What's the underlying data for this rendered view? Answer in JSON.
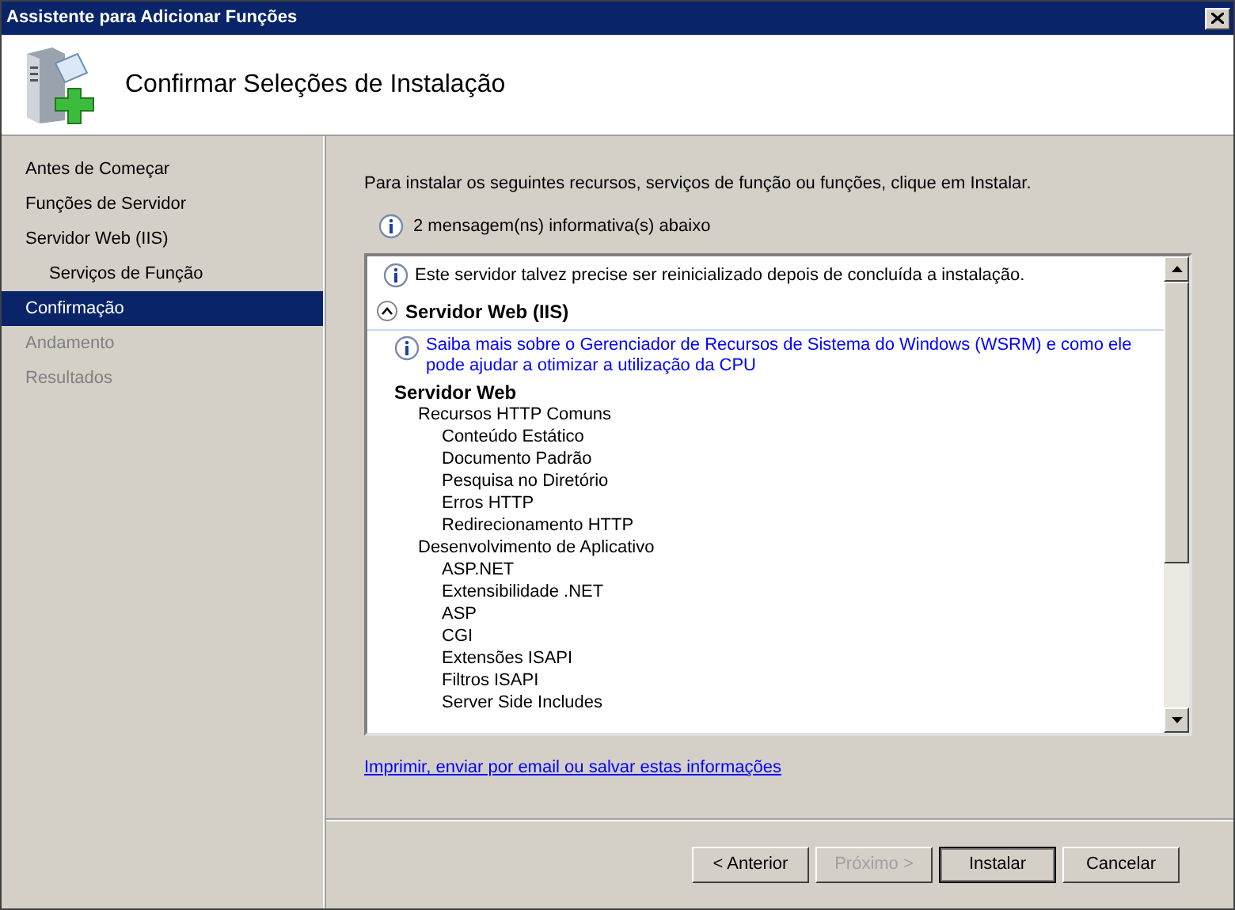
{
  "window": {
    "title": "Assistente para Adicionar Funções"
  },
  "header": {
    "title": "Confirmar Seleções de Instalação"
  },
  "sidebar": {
    "items": [
      {
        "label": "Antes de Começar",
        "selected": false,
        "disabled": false
      },
      {
        "label": "Funções de Servidor",
        "selected": false,
        "disabled": false
      },
      {
        "label": "Servidor Web (IIS)",
        "selected": false,
        "disabled": false,
        "children": [
          {
            "label": "Serviços de Função",
            "selected": false,
            "disabled": false
          }
        ]
      },
      {
        "label": "Confirmação",
        "selected": true,
        "disabled": false
      },
      {
        "label": "Andamento",
        "selected": false,
        "disabled": true
      },
      {
        "label": "Resultados",
        "selected": false,
        "disabled": true
      }
    ]
  },
  "intro": "Para instalar os seguintes recursos, serviços de função ou funções, clique em Instalar.",
  "info_count": "2 mensagem(ns) informativa(s) abaixo",
  "details": {
    "notice": "Este servidor talvez precise ser reinicializado depois de concluída a instalação.",
    "section": {
      "title": "Servidor Web (IIS)",
      "expanded": true,
      "link": "Saiba mais sobre o Gerenciador de Recursos de Sistema do Windows (WSRM) e como ele pode ajudar a otimizar a utilização da CPU",
      "tree": [
        {
          "label": "Servidor Web",
          "children": [
            {
              "label": "Recursos HTTP Comuns",
              "children": [
                {
                  "label": "Conteúdo Estático"
                },
                {
                  "label": "Documento Padrão"
                },
                {
                  "label": "Pesquisa no Diretório"
                },
                {
                  "label": "Erros HTTP"
                },
                {
                  "label": "Redirecionamento HTTP"
                }
              ]
            },
            {
              "label": "Desenvolvimento de Aplicativo",
              "children": [
                {
                  "label": "ASP.NET"
                },
                {
                  "label": "Extensibilidade .NET"
                },
                {
                  "label": "ASP"
                },
                {
                  "label": "CGI"
                },
                {
                  "label": "Extensões ISAPI"
                },
                {
                  "label": "Filtros ISAPI"
                },
                {
                  "label": "Server Side Includes"
                }
              ]
            }
          ]
        }
      ]
    }
  },
  "footer_link": "Imprimir, enviar por email ou salvar estas informações",
  "buttons": [
    {
      "label": "< Anterior",
      "disabled": false,
      "default": false
    },
    {
      "label": "Próximo >",
      "disabled": true,
      "default": false
    },
    {
      "label": "Instalar",
      "disabled": false,
      "default": true
    },
    {
      "label": "Cancelar",
      "disabled": false,
      "default": false
    }
  ]
}
